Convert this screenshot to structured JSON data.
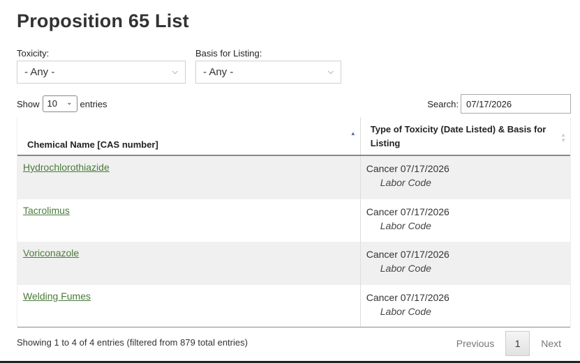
{
  "page": {
    "title": "Proposition 65 List"
  },
  "filters": {
    "toxicity_label": "Toxicity:",
    "toxicity_value": "- Any -",
    "basis_label": "Basis for Listing:",
    "basis_value": "- Any -"
  },
  "controls": {
    "show_label": "Show",
    "entries_value": "10",
    "entries_label": "entries",
    "search_label": "Search:",
    "search_value": "07/17/2026"
  },
  "table": {
    "columns": [
      "Chemical Name [CAS number]",
      "Type of Toxicity (Date Listed) & Basis for Listing"
    ],
    "rows": [
      {
        "chemical": "Hydrochlorothiazide",
        "toxicity": "Cancer 07/17/2026",
        "basis": "Labor Code"
      },
      {
        "chemical": "Tacrolimus",
        "toxicity": "Cancer 07/17/2026",
        "basis": "Labor Code"
      },
      {
        "chemical": "Voriconazole",
        "toxicity": "Cancer 07/17/2026",
        "basis": "Labor Code"
      },
      {
        "chemical": "Welding Fumes",
        "toxicity": "Cancer 07/17/2026",
        "basis": "Labor Code"
      }
    ]
  },
  "footer": {
    "info": "Showing 1 to 4 of 4 entries (filtered from 879 total entries)",
    "previous": "Previous",
    "current_page": "1",
    "next": "Next"
  },
  "colors": {
    "link": "#4a7a3a",
    "row_shade": "#f0f0f0",
    "sort_active": "#5a6ab0"
  }
}
